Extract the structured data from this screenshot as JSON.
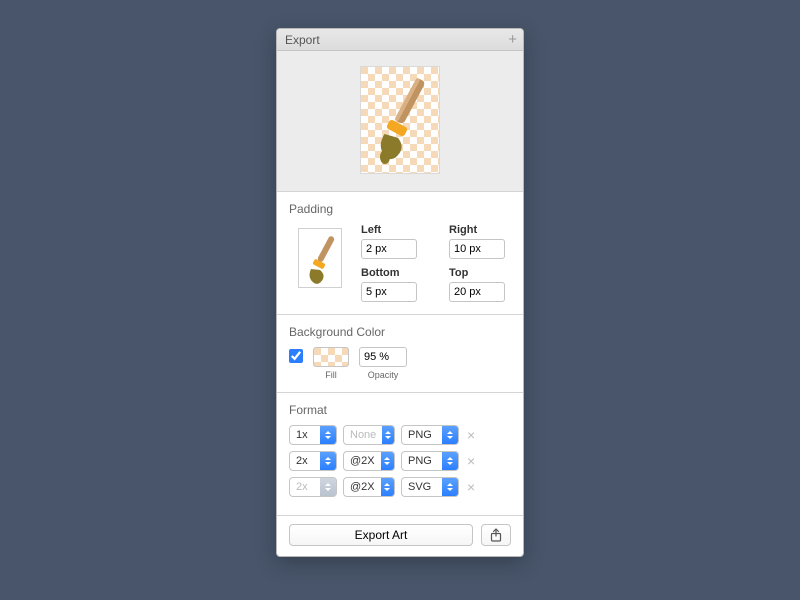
{
  "title": "Export",
  "padding": {
    "section_label": "Padding",
    "left_label": "Left",
    "left_value": "2 px",
    "right_label": "Right",
    "right_value": "10 px",
    "bottom_label": "Bottom",
    "bottom_value": "5 px",
    "top_label": "Top",
    "top_value": "20 px"
  },
  "background": {
    "section_label": "Background Color",
    "fill_label": "Fill",
    "opacity_value": "95 %",
    "opacity_label": "Opacity",
    "checked": true,
    "fill_color": "#f5d9b9"
  },
  "format": {
    "section_label": "Format",
    "rows": [
      {
        "scale": "1x",
        "suffix": "",
        "suffix_placeholder": "None",
        "type": "PNG",
        "disabled": false
      },
      {
        "scale": "2x",
        "suffix": "@2X",
        "suffix_placeholder": "",
        "type": "PNG",
        "disabled": false
      },
      {
        "scale": "2x",
        "suffix": "@2X",
        "suffix_placeholder": "",
        "type": "SVG",
        "disabled": true
      }
    ]
  },
  "footer": {
    "export_label": "Export Art"
  }
}
